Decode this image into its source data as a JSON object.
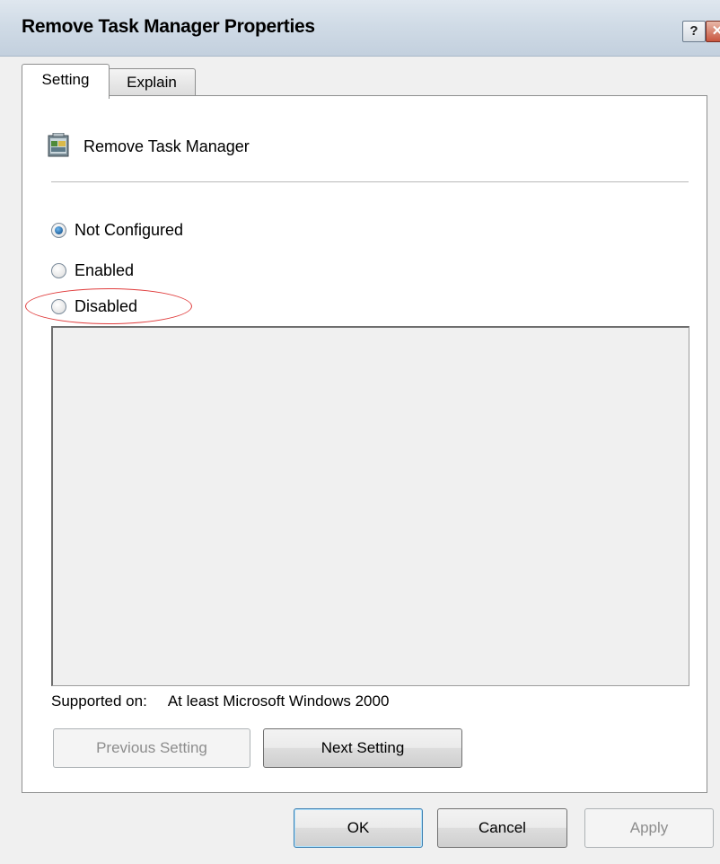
{
  "window": {
    "title": "Remove Task Manager Properties",
    "help_glyph": "?",
    "close_glyph": "✕"
  },
  "tabs": [
    {
      "label": "Setting",
      "active": true
    },
    {
      "label": "Explain",
      "active": false
    }
  ],
  "policy": {
    "name": "Remove Task Manager",
    "icon": "policy-setting-icon"
  },
  "options": [
    {
      "label": "Not Configured",
      "checked": true
    },
    {
      "label": "Enabled",
      "checked": false
    },
    {
      "label": "Disabled",
      "checked": false,
      "highlighted": true
    }
  ],
  "supported": {
    "label": "Supported on:",
    "value": "At least Microsoft Windows 2000"
  },
  "nav_buttons": {
    "previous": {
      "label": "Previous Setting",
      "enabled": false
    },
    "next": {
      "label": "Next Setting",
      "enabled": true
    }
  },
  "footer_buttons": {
    "ok": {
      "label": "OK",
      "enabled": true
    },
    "cancel": {
      "label": "Cancel",
      "enabled": true
    },
    "apply": {
      "label": "Apply",
      "enabled": false
    }
  },
  "colors": {
    "highlight_ellipse": "#e03c3c",
    "radio_selected": "#1f5f9a"
  }
}
